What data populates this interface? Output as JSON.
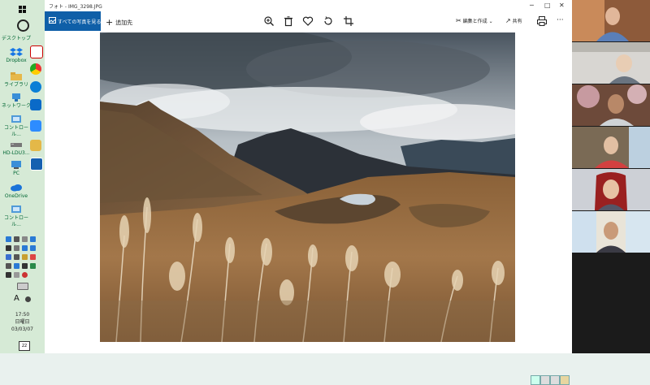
{
  "app": {
    "title": "フォト - IMG_3298.JPG",
    "window_controls": [
      "minimize",
      "maximize",
      "close"
    ]
  },
  "toolbar": {
    "see_all_label": "すべての写真を見る",
    "add_to_label": "追加先",
    "tools": [
      {
        "name": "zoom-icon"
      },
      {
        "name": "delete-icon"
      },
      {
        "name": "favorite-icon"
      },
      {
        "name": "rotate-icon"
      },
      {
        "name": "crop-icon"
      }
    ],
    "edit_label": "編集と作成",
    "share_label": "共有",
    "print_icon": "print-icon",
    "more_icon": "more-icon"
  },
  "desktop": {
    "items": [
      {
        "label": "デスクトップ"
      },
      {
        "label": "Dropbox"
      },
      {
        "label": "ライブラリ"
      },
      {
        "label": "ネットワーク"
      },
      {
        "label": "コントロール..."
      },
      {
        "label": "HD-LDU3..."
      },
      {
        "label": "PC"
      },
      {
        "label": "OneDrive"
      },
      {
        "label": "コントロール..."
      }
    ]
  },
  "tray": {
    "input_mode": "A",
    "time": "17:50",
    "day": "日曜日",
    "date": "03/03/07",
    "notification_count": "22"
  },
  "colors": {
    "accent": "#0f5fa8",
    "taskbar": "#d6ead6"
  },
  "video_tiles": [
    {
      "name": "participant-1"
    },
    {
      "name": "participant-2"
    },
    {
      "name": "participant-3"
    },
    {
      "name": "participant-4"
    },
    {
      "name": "participant-5"
    },
    {
      "name": "participant-6"
    }
  ]
}
